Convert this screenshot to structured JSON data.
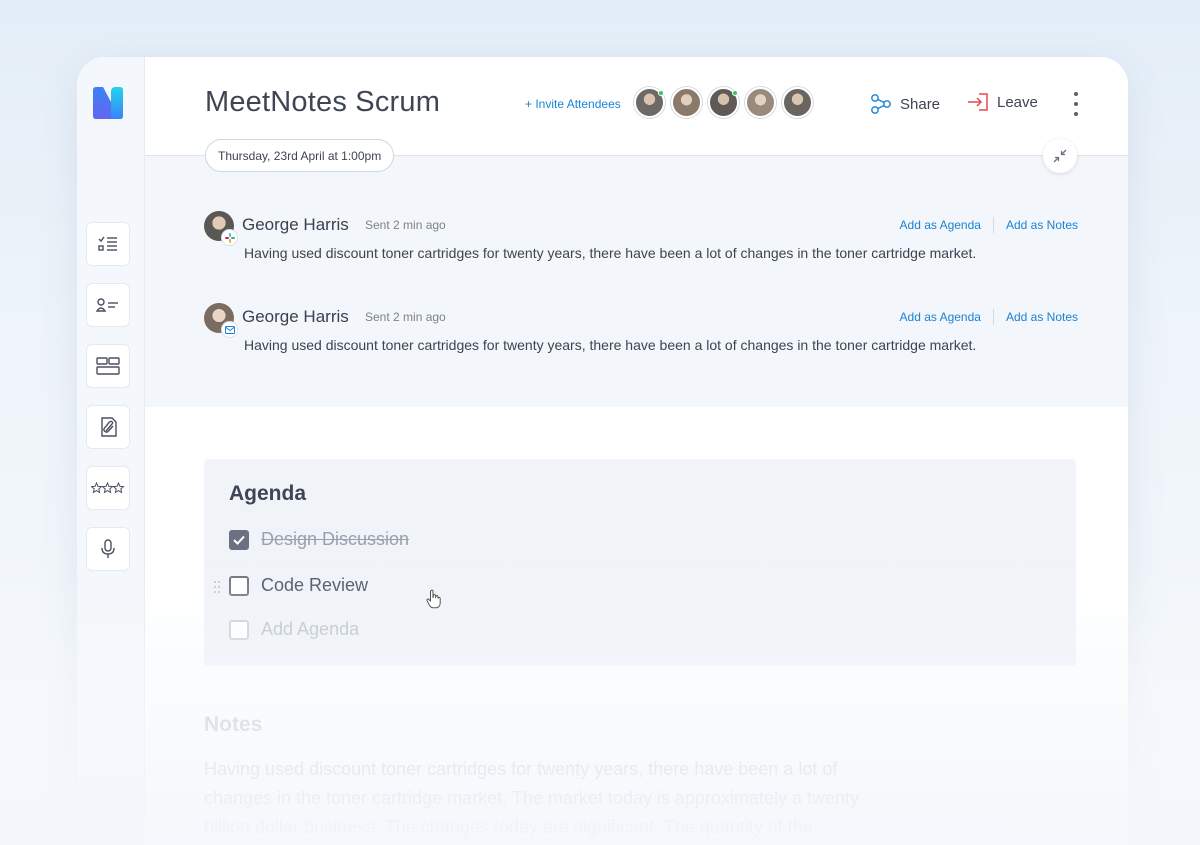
{
  "header": {
    "title": "MeetNotes Scrum",
    "invite_label": "+ Invite Attendees",
    "share_label": "Share",
    "leave_label": "Leave",
    "date_label": "Thursday, 23rd April at 1:00pm"
  },
  "attendees": [
    {
      "online": true,
      "color": "#6d6a66"
    },
    {
      "online": false,
      "color": "#8a7a6c"
    },
    {
      "online": true,
      "color": "#5f5a55"
    },
    {
      "online": false,
      "color": "#9a8a7c"
    },
    {
      "online": false,
      "color": "#6a6560"
    }
  ],
  "sidebar": {
    "items": [
      {
        "icon": "checklist-icon"
      },
      {
        "icon": "contact-list-icon"
      },
      {
        "icon": "layout-icon"
      },
      {
        "icon": "attachment-icon"
      },
      {
        "icon": "rating-stars-icon"
      },
      {
        "icon": "microphone-icon"
      }
    ]
  },
  "messages": [
    {
      "name": "George Harris",
      "time": "Sent 2 min ago",
      "source_icon": "slack-icon",
      "text": "Having used discount toner cartridges for twenty years, there have been a lot of changes in the toner cartridge market.",
      "add_agenda": "Add as Agenda",
      "add_notes": "Add as Notes"
    },
    {
      "name": "George Harris",
      "time": "Sent 2 min ago",
      "source_icon": "mail-icon",
      "text": "Having used discount toner cartridges for twenty years, there have been a lot of changes in the toner cartridge market.",
      "add_agenda": "Add as Agenda",
      "add_notes": "Add as Notes"
    }
  ],
  "agenda": {
    "title": "Agenda",
    "items": [
      {
        "label": "Design Discussion",
        "checked": true
      },
      {
        "label": "Code Review",
        "checked": false
      },
      {
        "label": "Add Agenda",
        "checked": false,
        "placeholder": true
      }
    ]
  },
  "notes": {
    "title": "Notes",
    "text": "Having used discount toner cartridges for twenty years, there have been a lot of changes in the toner cartridge market. The market today is approximately a twenty billion dollar business. The changes today are significant. The quantity of the"
  },
  "colors": {
    "accent": "#1a83d6",
    "leave_icon": "#e5484d",
    "text": "#3d4452"
  }
}
